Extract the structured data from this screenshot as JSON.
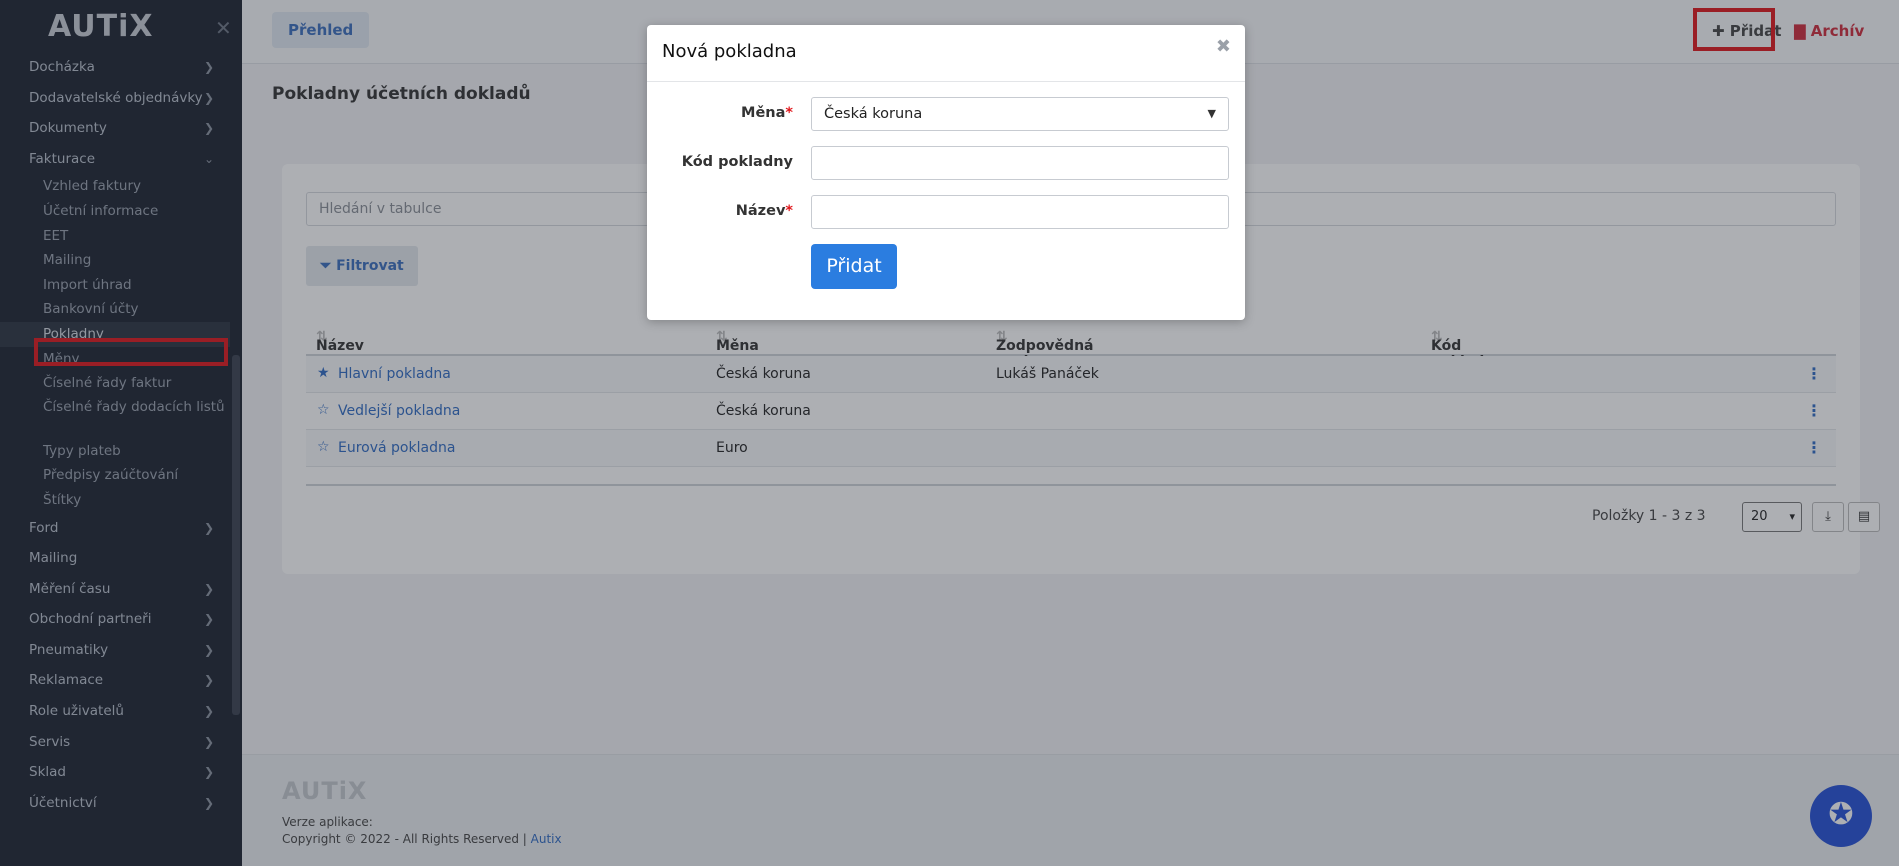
{
  "sidebar": {
    "logo": "AUTiX",
    "items": [
      {
        "label": "Docházka"
      },
      {
        "label": "Dodavatelské objednávky"
      },
      {
        "label": "Dokumenty"
      },
      {
        "label": "Fakturace"
      }
    ],
    "fakturace_sub": [
      "Vzhled faktury",
      "Účetní informace",
      "EET",
      "Mailing",
      "Import úhrad",
      "Bankovní účty",
      "Pokladny",
      "Měny",
      "Číselné řady faktur",
      "Číselné řady dodacích listů",
      "Typy plateb",
      "Předpisy zaúčtování",
      "Štítky"
    ],
    "items_after": [
      {
        "label": "Ford"
      },
      {
        "label": "Mailing"
      },
      {
        "label": "Měření času"
      },
      {
        "label": "Obchodní partneři"
      },
      {
        "label": "Pneumatiky"
      },
      {
        "label": "Reklamace"
      },
      {
        "label": "Role uživatelů"
      },
      {
        "label": "Servis"
      },
      {
        "label": "Sklad"
      },
      {
        "label": "Účetnictví"
      }
    ]
  },
  "topbar": {
    "overview_label": "Přehled",
    "add_label": "Přidat",
    "archive_label": "Archív"
  },
  "page": {
    "title": "Pokladny účetních dokladů",
    "search_placeholder": "Hledání v tabulce",
    "filter_label": "Filtrovat"
  },
  "table": {
    "headers": [
      "Název",
      "Měna",
      "Zodpovědná osoba",
      "Kód pokladny"
    ],
    "rows": [
      {
        "name": "Hlavní pokladna",
        "currency": "Česká koruna",
        "person": "Lukáš Panáček",
        "code": "",
        "starred": true
      },
      {
        "name": "Vedlejší pokladna",
        "currency": "Česká koruna",
        "person": "",
        "code": "",
        "starred": false
      },
      {
        "name": "Eurová pokladna",
        "currency": "Euro",
        "person": "",
        "code": "",
        "starred": false
      }
    ]
  },
  "pager": {
    "items_text": "Položky 1 - 3 z 3",
    "page_size": "20"
  },
  "footer": {
    "logo": "AUTiX",
    "version_label": "Verze aplikace:",
    "copyright": "Copyright © 2022 - All Rights Reserved |",
    "link": "Autix"
  },
  "modal": {
    "title": "Nová pokladna",
    "currency_label": "Měna",
    "currency_value": "Česká koruna",
    "code_label": "Kód pokladny",
    "name_label": "Název",
    "submit_label": "Přidat",
    "required_mark": "*"
  },
  "icons": {
    "close": "close-icon",
    "chevron": "chevron-right-icon",
    "star_filled": "star-filled-icon",
    "star_outline": "star-outline-icon",
    "kebab": "kebab-menu-icon",
    "download": "download-icon",
    "file": "file-icon",
    "plus": "plus-icon",
    "archive": "archive-icon",
    "filter": "filter-icon",
    "chat": "chat-support-icon",
    "sort": "sort-icon",
    "caret": "caret-down-icon"
  },
  "colors": {
    "sidebar_bg": "#1c2230",
    "accent": "#2b7de0",
    "highlight": "#e0161b",
    "archive": "#cf2b3a"
  }
}
